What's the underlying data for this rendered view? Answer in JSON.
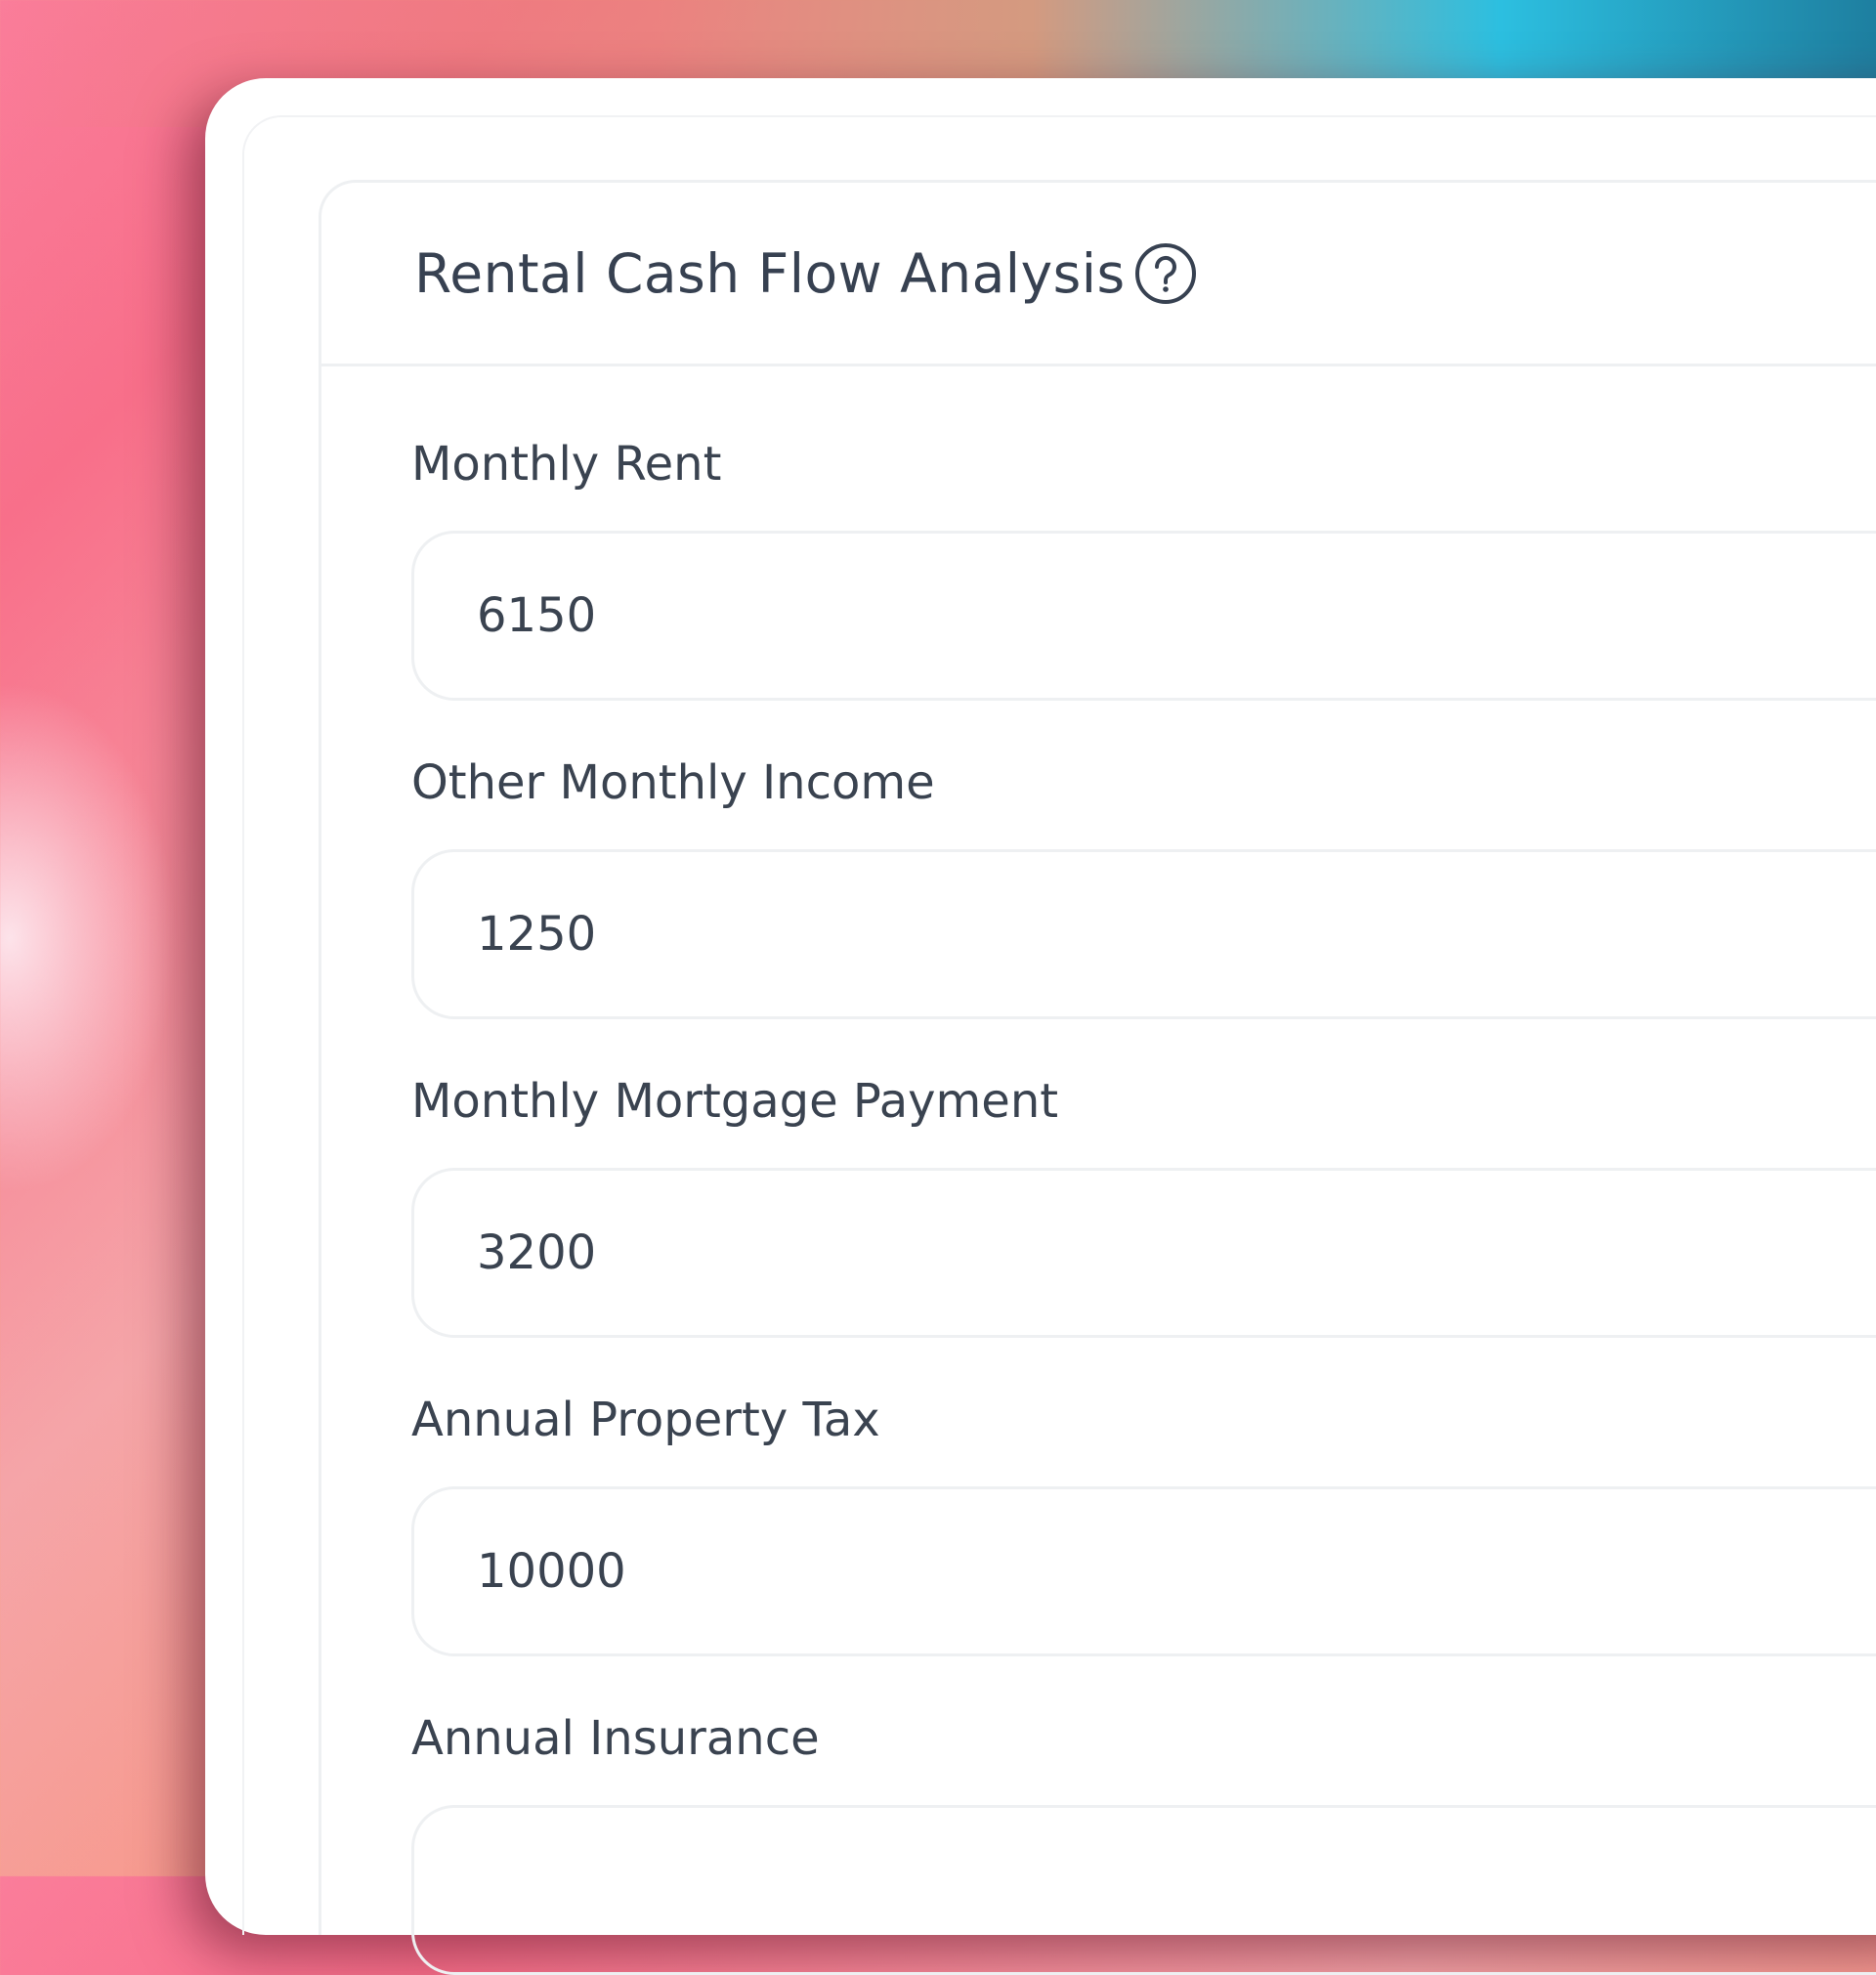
{
  "card": {
    "title": "Rental Cash Flow Analysis"
  },
  "fields": [
    {
      "label": "Monthly Rent",
      "value": "6150"
    },
    {
      "label": "Other Monthly Income",
      "value": "1250"
    },
    {
      "label": "Monthly Mortgage Payment",
      "value": "3200"
    },
    {
      "label": "Annual Property Tax",
      "value": "10000"
    },
    {
      "label": "Annual Insurance",
      "value": ""
    }
  ],
  "icons": {
    "help": "question-circle-icon"
  },
  "colors": {
    "text": "#3a4350",
    "border": "#eef0f2",
    "card_background": "#ffffff"
  }
}
